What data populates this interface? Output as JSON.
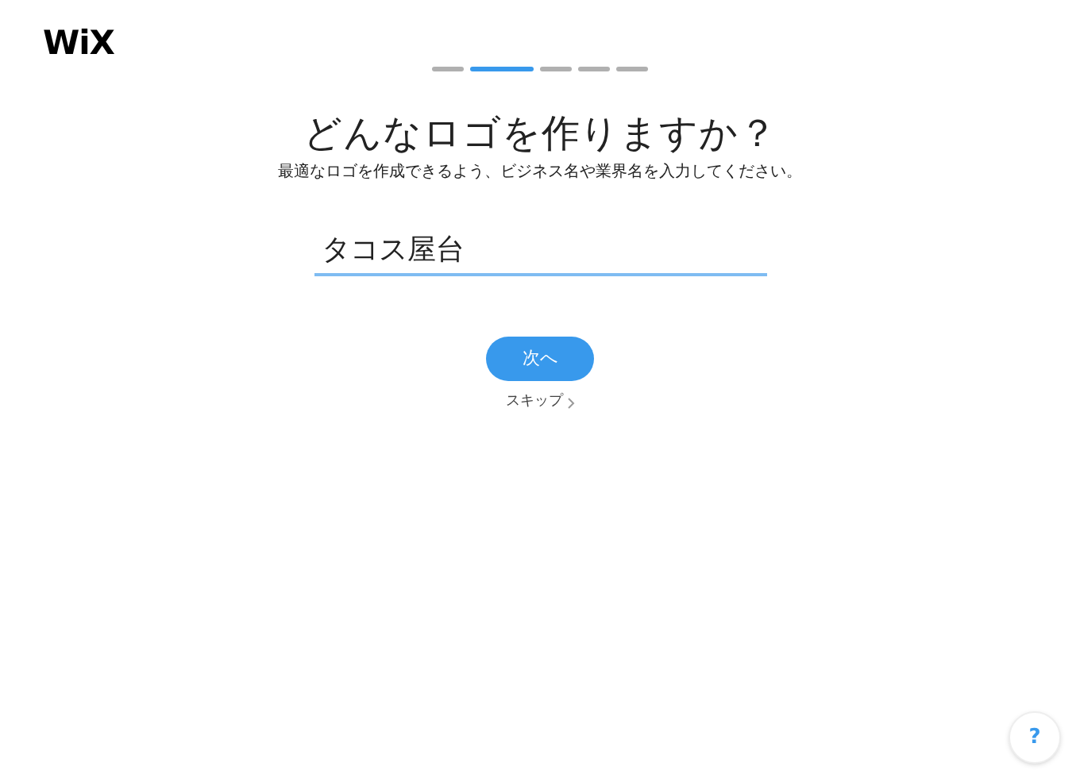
{
  "logo": "WiX",
  "steps": [
    {
      "selected": false
    },
    {
      "selected": true
    },
    {
      "selected": false
    },
    {
      "selected": false
    },
    {
      "selected": false
    }
  ],
  "title": "どんなロゴを作りますか？",
  "subtitle": "最適なロゴを作成できるよう、ビジネス名や業界名を入力してください。",
  "name_field": {
    "value": "タコス屋台"
  },
  "next_button": "次へ",
  "skip_link": "スキップ",
  "help_button": "?"
}
